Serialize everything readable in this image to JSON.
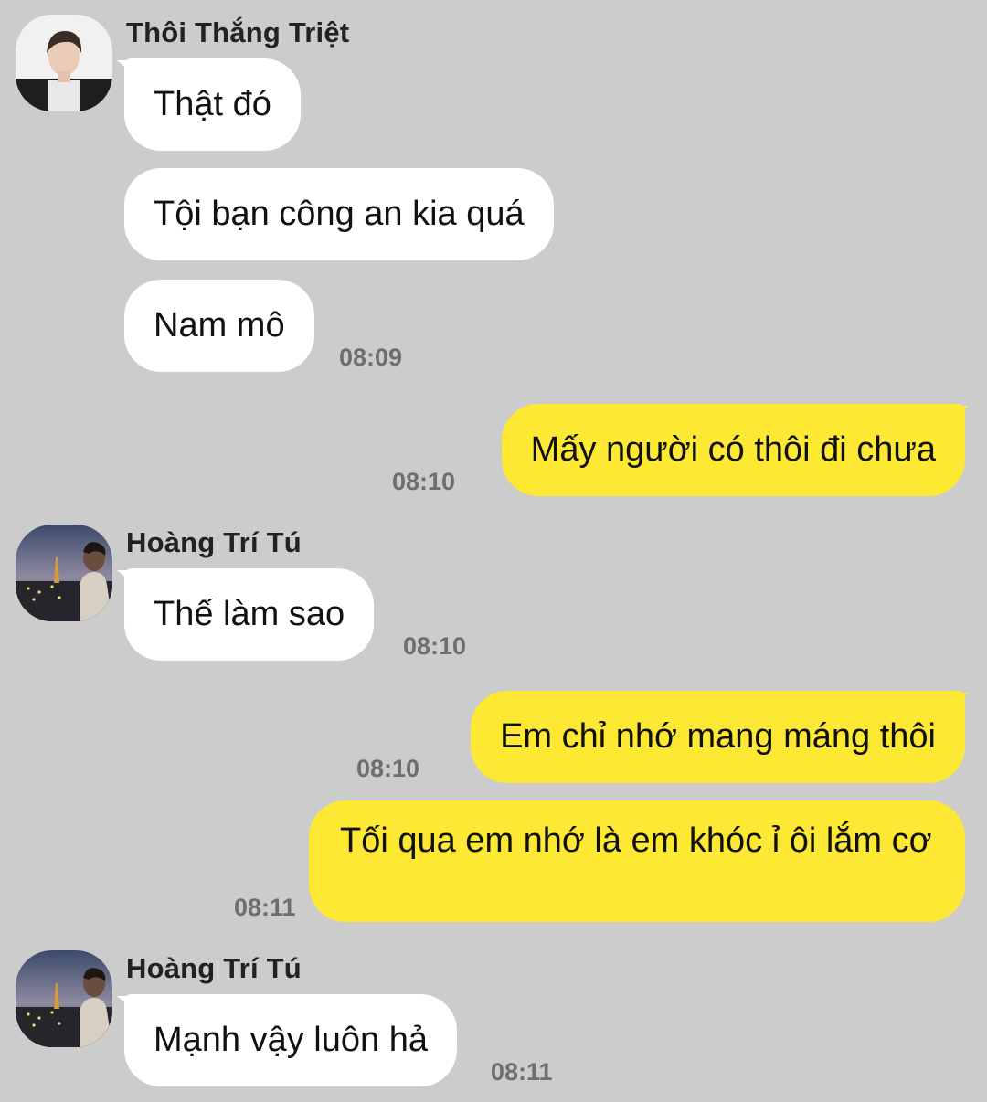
{
  "conversation": {
    "groups": [
      {
        "sender": "Thôi Thắng Triệt",
        "avatar_icon": "person-portrait-icon",
        "messages": [
          {
            "text": "Thật đó"
          },
          {
            "text": "Tội bạn công an kia quá"
          },
          {
            "text": "Nam mô",
            "time": "08:09"
          }
        ]
      },
      {
        "outgoing": true,
        "messages": [
          {
            "text": "Mấy người có thôi đi chưa",
            "time": "08:10"
          }
        ]
      },
      {
        "sender": "Hoàng Trí Tú",
        "avatar_icon": "person-night-city-icon",
        "messages": [
          {
            "text": "Thế làm sao",
            "time": "08:10"
          }
        ]
      },
      {
        "outgoing": true,
        "messages": [
          {
            "text": "Em chỉ nhớ mang máng thôi",
            "time": "08:10"
          },
          {
            "text": "Tối qua em nhớ là em khóc ỉ ôi lắm cơ",
            "time": "08:11"
          }
        ]
      },
      {
        "sender": "Hoàng Trí Tú",
        "avatar_icon": "person-night-city-icon",
        "messages": [
          {
            "text": "Mạnh vậy luôn hả",
            "time": "08:11"
          }
        ]
      }
    ]
  },
  "colors": {
    "background": "#cccccc",
    "incoming_bubble": "#ffffff",
    "outgoing_bubble": "#fde834",
    "timestamp": "#6e6e6e"
  }
}
